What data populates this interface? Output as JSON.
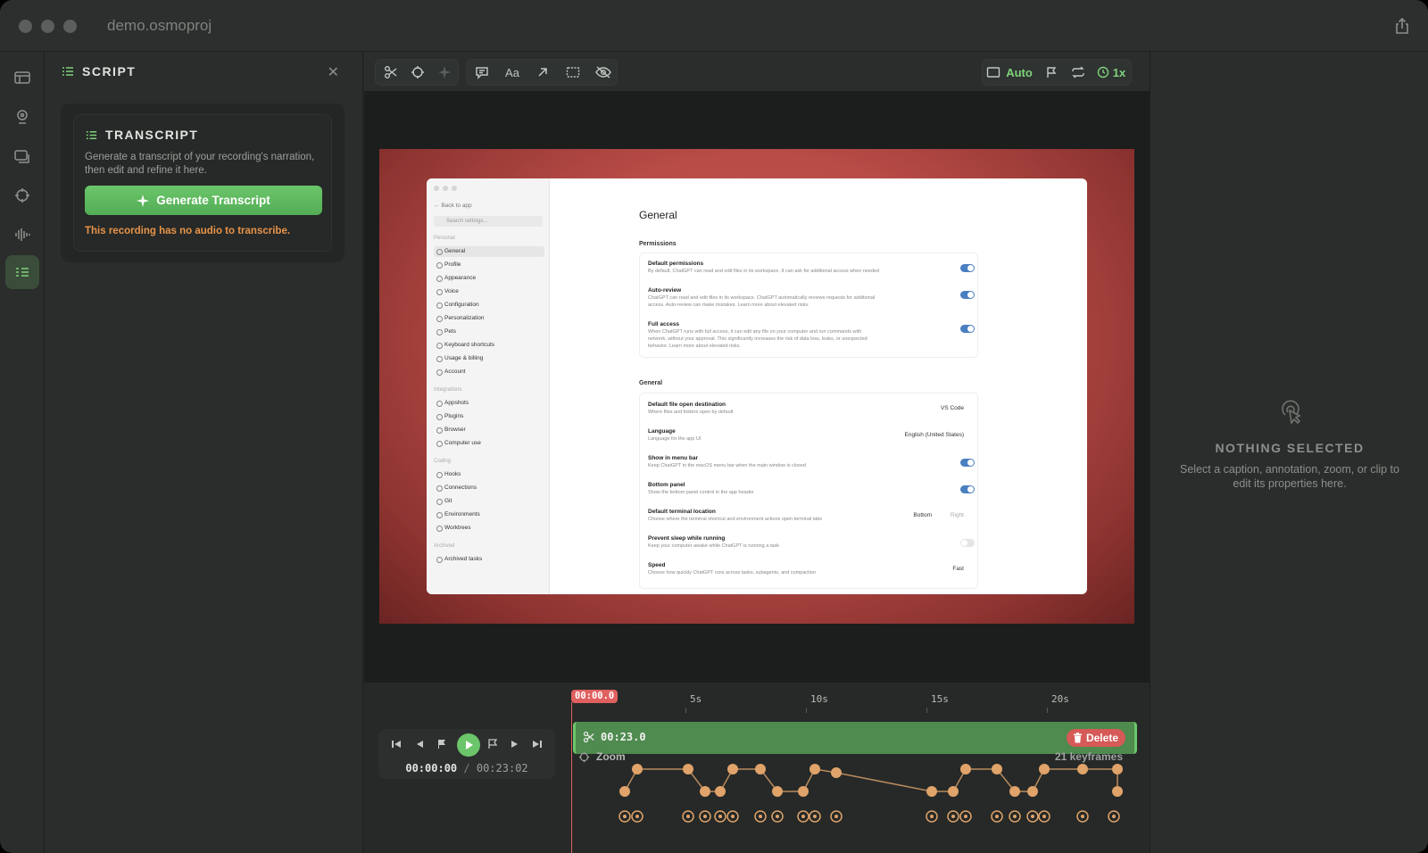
{
  "window": {
    "title": "demo.osmoproj"
  },
  "rail": {
    "items": [
      "layout-icon",
      "webcam-icon",
      "screens-icon",
      "crosshair-icon",
      "audio-icon",
      "script-icon"
    ]
  },
  "script_panel": {
    "title": "SCRIPT",
    "transcript": {
      "title": "TRANSCRIPT",
      "description": "Generate a transcript of your recording's narration, then edit and refine it here.",
      "button": "Generate Transcript",
      "warning": "This recording has no audio to transcribe."
    }
  },
  "toolbar": {
    "auto_label": "Auto",
    "speed_label": "1x"
  },
  "preview": {
    "sidebar": {
      "back": "Back to app",
      "search": "Search settings...",
      "sections": [
        {
          "label": "Personal",
          "items": [
            "General",
            "Profile",
            "Appearance",
            "Voice",
            "Configuration",
            "Personalization",
            "Pets",
            "Keyboard shortcuts",
            "Usage & billing",
            "Account"
          ]
        },
        {
          "label": "Integrations",
          "items": [
            "Appshots",
            "Plugins",
            "Browser",
            "Computer use"
          ]
        },
        {
          "label": "Coding",
          "items": [
            "Hooks",
            "Connections",
            "Git",
            "Environments",
            "Worktrees"
          ]
        },
        {
          "label": "Archived",
          "items": [
            "Archived tasks"
          ]
        }
      ]
    },
    "main": {
      "title": "General",
      "permissions_label": "Permissions",
      "permissions": [
        {
          "title": "Default permissions",
          "desc": "By default, ChatGPT can read and edit files in its workspace. It can ask for additional access when needed",
          "on": true
        },
        {
          "title": "Auto-review",
          "desc": "ChatGPT can read and edit files in its workspace. ChatGPT automatically reviews requests for additional access. Auto-review can make mistakes. Learn more about elevated risks.",
          "on": true
        },
        {
          "title": "Full access",
          "desc": "When ChatGPT runs with full access, it can edit any file on your computer and run commands with network, without your approval. This significantly increases the risk of data loss, leaks, or unexpected behavior. Learn more about elevated risks.",
          "on": true
        }
      ],
      "general_label": "General",
      "general": [
        {
          "title": "Default file open destination",
          "desc": "Where files and folders open by default",
          "value": "VS Code"
        },
        {
          "title": "Language",
          "desc": "Language for the app UI",
          "value": "English (United States)"
        },
        {
          "title": "Show in menu bar",
          "desc": "Keep ChatGPT in the macOS menu bar when the main window is closed",
          "toggle": true
        },
        {
          "title": "Bottom panel",
          "desc": "Show the bottom panel control in the app header",
          "toggle": true
        },
        {
          "title": "Default terminal location",
          "desc": "Choose where the terminal shortcut and environment actions open terminal tabs",
          "value": "Bottom",
          "value2": "Right"
        },
        {
          "title": "Prevent sleep while running",
          "desc": "Keep your computer awake while ChatGPT is running a task",
          "toggle": false
        },
        {
          "title": "Speed",
          "desc": "Choose how quickly ChatGPT runs across tasks, subagents, and compaction",
          "value": "Fast"
        }
      ]
    }
  },
  "inspector": {
    "title": "NOTHING SELECTED",
    "description": "Select a caption, annotation, zoom, or clip to edit its properties here."
  },
  "timeline": {
    "playhead": "00:00.0",
    "ticks": [
      "5s",
      "10s",
      "15s",
      "20s"
    ],
    "current_time": "00:00:00",
    "separator": "/",
    "total_time": "00:23:02",
    "clip_duration": "00:23.0",
    "delete_label": "Delete",
    "zoom_label": "Zoom",
    "keyframes_label": "21 keyframes"
  },
  "colors": {
    "accent": "#6bc56a",
    "danger": "#d65a57",
    "keyframe": "#e0a36a"
  }
}
